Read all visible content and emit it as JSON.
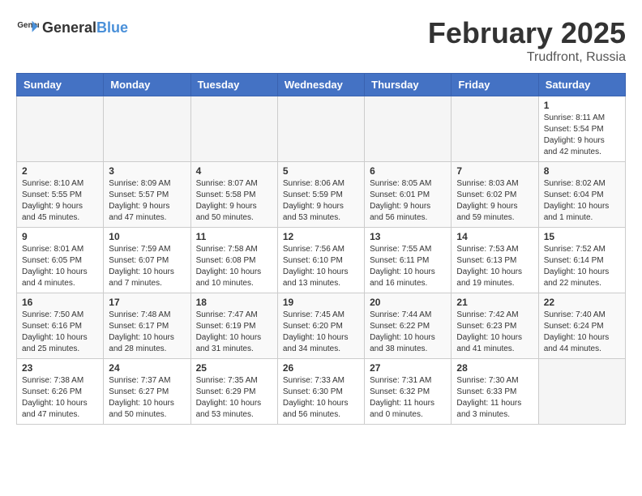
{
  "header": {
    "logo_general": "General",
    "logo_blue": "Blue",
    "title": "February 2025",
    "subtitle": "Trudfront, Russia"
  },
  "weekdays": [
    "Sunday",
    "Monday",
    "Tuesday",
    "Wednesday",
    "Thursday",
    "Friday",
    "Saturday"
  ],
  "weeks": [
    [
      {
        "day": "",
        "info": ""
      },
      {
        "day": "",
        "info": ""
      },
      {
        "day": "",
        "info": ""
      },
      {
        "day": "",
        "info": ""
      },
      {
        "day": "",
        "info": ""
      },
      {
        "day": "",
        "info": ""
      },
      {
        "day": "1",
        "info": "Sunrise: 8:11 AM\nSunset: 5:54 PM\nDaylight: 9 hours and 42 minutes."
      }
    ],
    [
      {
        "day": "2",
        "info": "Sunrise: 8:10 AM\nSunset: 5:55 PM\nDaylight: 9 hours and 45 minutes."
      },
      {
        "day": "3",
        "info": "Sunrise: 8:09 AM\nSunset: 5:57 PM\nDaylight: 9 hours and 47 minutes."
      },
      {
        "day": "4",
        "info": "Sunrise: 8:07 AM\nSunset: 5:58 PM\nDaylight: 9 hours and 50 minutes."
      },
      {
        "day": "5",
        "info": "Sunrise: 8:06 AM\nSunset: 5:59 PM\nDaylight: 9 hours and 53 minutes."
      },
      {
        "day": "6",
        "info": "Sunrise: 8:05 AM\nSunset: 6:01 PM\nDaylight: 9 hours and 56 minutes."
      },
      {
        "day": "7",
        "info": "Sunrise: 8:03 AM\nSunset: 6:02 PM\nDaylight: 9 hours and 59 minutes."
      },
      {
        "day": "8",
        "info": "Sunrise: 8:02 AM\nSunset: 6:04 PM\nDaylight: 10 hours and 1 minute."
      }
    ],
    [
      {
        "day": "9",
        "info": "Sunrise: 8:01 AM\nSunset: 6:05 PM\nDaylight: 10 hours and 4 minutes."
      },
      {
        "day": "10",
        "info": "Sunrise: 7:59 AM\nSunset: 6:07 PM\nDaylight: 10 hours and 7 minutes."
      },
      {
        "day": "11",
        "info": "Sunrise: 7:58 AM\nSunset: 6:08 PM\nDaylight: 10 hours and 10 minutes."
      },
      {
        "day": "12",
        "info": "Sunrise: 7:56 AM\nSunset: 6:10 PM\nDaylight: 10 hours and 13 minutes."
      },
      {
        "day": "13",
        "info": "Sunrise: 7:55 AM\nSunset: 6:11 PM\nDaylight: 10 hours and 16 minutes."
      },
      {
        "day": "14",
        "info": "Sunrise: 7:53 AM\nSunset: 6:13 PM\nDaylight: 10 hours and 19 minutes."
      },
      {
        "day": "15",
        "info": "Sunrise: 7:52 AM\nSunset: 6:14 PM\nDaylight: 10 hours and 22 minutes."
      }
    ],
    [
      {
        "day": "16",
        "info": "Sunrise: 7:50 AM\nSunset: 6:16 PM\nDaylight: 10 hours and 25 minutes."
      },
      {
        "day": "17",
        "info": "Sunrise: 7:48 AM\nSunset: 6:17 PM\nDaylight: 10 hours and 28 minutes."
      },
      {
        "day": "18",
        "info": "Sunrise: 7:47 AM\nSunset: 6:19 PM\nDaylight: 10 hours and 31 minutes."
      },
      {
        "day": "19",
        "info": "Sunrise: 7:45 AM\nSunset: 6:20 PM\nDaylight: 10 hours and 34 minutes."
      },
      {
        "day": "20",
        "info": "Sunrise: 7:44 AM\nSunset: 6:22 PM\nDaylight: 10 hours and 38 minutes."
      },
      {
        "day": "21",
        "info": "Sunrise: 7:42 AM\nSunset: 6:23 PM\nDaylight: 10 hours and 41 minutes."
      },
      {
        "day": "22",
        "info": "Sunrise: 7:40 AM\nSunset: 6:24 PM\nDaylight: 10 hours and 44 minutes."
      }
    ],
    [
      {
        "day": "23",
        "info": "Sunrise: 7:38 AM\nSunset: 6:26 PM\nDaylight: 10 hours and 47 minutes."
      },
      {
        "day": "24",
        "info": "Sunrise: 7:37 AM\nSunset: 6:27 PM\nDaylight: 10 hours and 50 minutes."
      },
      {
        "day": "25",
        "info": "Sunrise: 7:35 AM\nSunset: 6:29 PM\nDaylight: 10 hours and 53 minutes."
      },
      {
        "day": "26",
        "info": "Sunrise: 7:33 AM\nSunset: 6:30 PM\nDaylight: 10 hours and 56 minutes."
      },
      {
        "day": "27",
        "info": "Sunrise: 7:31 AM\nSunset: 6:32 PM\nDaylight: 11 hours and 0 minutes."
      },
      {
        "day": "28",
        "info": "Sunrise: 7:30 AM\nSunset: 6:33 PM\nDaylight: 11 hours and 3 minutes."
      },
      {
        "day": "",
        "info": ""
      }
    ]
  ]
}
